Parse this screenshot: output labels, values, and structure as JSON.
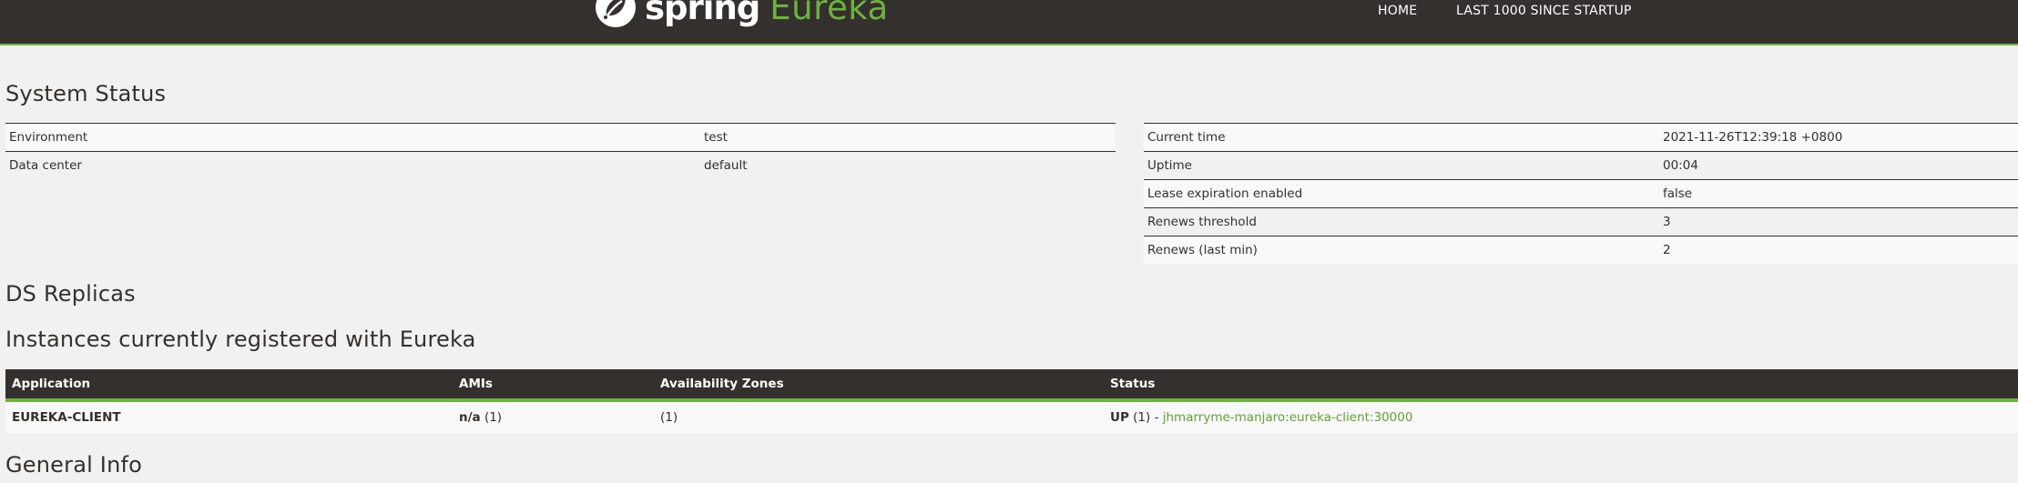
{
  "nav": {
    "brand_spring": "spring",
    "brand_eureka": "Eureka",
    "home": "HOME",
    "last_1000": "LAST 1000 SINCE STARTUP"
  },
  "colors": {
    "navbar_bg": "#34302d",
    "accent_green": "#6db33f",
    "link_green": "#5fa134",
    "page_bg": "#f1f1f1"
  },
  "system_status": {
    "title": "System Status",
    "environment": [
      {
        "key": "Environment",
        "value": "test"
      },
      {
        "key": "Data center",
        "value": "default"
      }
    ],
    "time": [
      {
        "key": "Current time",
        "value": "2021-11-26T12:39:18 +0800"
      },
      {
        "key": "Uptime",
        "value": "00:04"
      },
      {
        "key": "Lease expiration enabled",
        "value": "false"
      },
      {
        "key": "Renews threshold",
        "value": "3"
      },
      {
        "key": "Renews (last min)",
        "value": "2"
      }
    ]
  },
  "ds_replicas": {
    "title": "DS Replicas"
  },
  "instances": {
    "title": "Instances currently registered with Eureka",
    "columns": [
      "Application",
      "AMIs",
      "Availability Zones",
      "Status"
    ],
    "rows": [
      {
        "application": "EUREKA-CLIENT",
        "amis_bold": "n/a",
        "amis_count": "(1)",
        "zones": "(1)",
        "status_bold": "UP",
        "status_count": "(1) -",
        "instance_link": "jhmarryme-manjaro:eureka-client:30000"
      }
    ]
  },
  "general_info": {
    "title": "General Info"
  }
}
